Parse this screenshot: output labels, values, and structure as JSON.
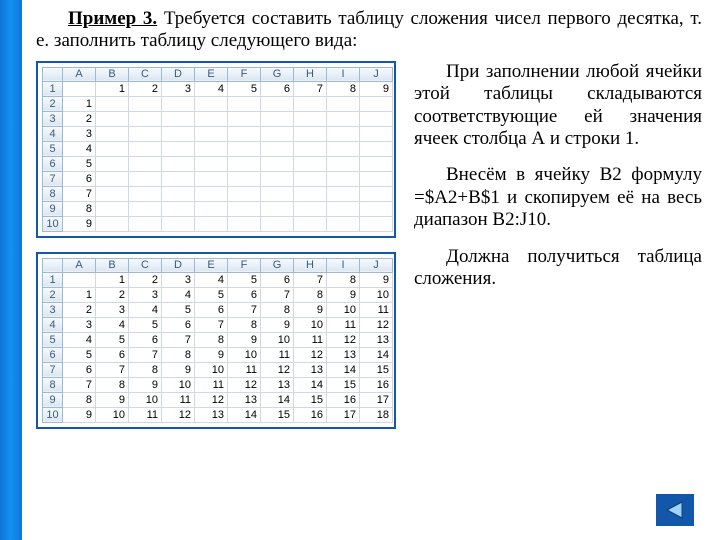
{
  "heading": "Пример 3.",
  "intro_tail": " Требуется составить таблицу сложения чисел первого десятка, т. е. заполнить таблицу следующего вида:",
  "para1": "При заполнении любой ячейки этой таблицы складываются соответствующие ей значения ячеек столбца А и строки 1.",
  "para2": "Внесём в ячейку В2 формулу =$A2+B$1 и скопируем её на весь диапазон В2:J10.",
  "para3": "Должна получиться таблица сложения.",
  "chart_data": [
    {
      "type": "table",
      "title": "Исходная таблица",
      "col_headers": [
        "",
        "A",
        "B",
        "C",
        "D",
        "E",
        "F",
        "G",
        "H",
        "I",
        "J"
      ],
      "row_headers": [
        "1",
        "2",
        "3",
        "4",
        "5",
        "6",
        "7",
        "8",
        "9",
        "10"
      ],
      "cells": [
        [
          "",
          "1",
          "2",
          "3",
          "4",
          "5",
          "6",
          "7",
          "8",
          "9"
        ],
        [
          "1",
          "",
          "",
          "",
          "",
          "",
          "",
          "",
          "",
          ""
        ],
        [
          "2",
          "",
          "",
          "",
          "",
          "",
          "",
          "",
          "",
          ""
        ],
        [
          "3",
          "",
          "",
          "",
          "",
          "",
          "",
          "",
          "",
          ""
        ],
        [
          "4",
          "",
          "",
          "",
          "",
          "",
          "",
          "",
          "",
          ""
        ],
        [
          "5",
          "",
          "",
          "",
          "",
          "",
          "",
          "",
          "",
          ""
        ],
        [
          "6",
          "",
          "",
          "",
          "",
          "",
          "",
          "",
          "",
          ""
        ],
        [
          "7",
          "",
          "",
          "",
          "",
          "",
          "",
          "",
          "",
          ""
        ],
        [
          "8",
          "",
          "",
          "",
          "",
          "",
          "",
          "",
          "",
          ""
        ],
        [
          "9",
          "",
          "",
          "",
          "",
          "",
          "",
          "",
          "",
          ""
        ]
      ]
    },
    {
      "type": "table",
      "title": "Таблица сложения",
      "col_headers": [
        "",
        "A",
        "B",
        "C",
        "D",
        "E",
        "F",
        "G",
        "H",
        "I",
        "J"
      ],
      "row_headers": [
        "1",
        "2",
        "3",
        "4",
        "5",
        "6",
        "7",
        "8",
        "9",
        "10"
      ],
      "cells": [
        [
          "",
          "1",
          "2",
          "3",
          "4",
          "5",
          "6",
          "7",
          "8",
          "9"
        ],
        [
          "1",
          "2",
          "3",
          "4",
          "5",
          "6",
          "7",
          "8",
          "9",
          "10"
        ],
        [
          "2",
          "3",
          "4",
          "5",
          "6",
          "7",
          "8",
          "9",
          "10",
          "11"
        ],
        [
          "3",
          "4",
          "5",
          "6",
          "7",
          "8",
          "9",
          "10",
          "11",
          "12"
        ],
        [
          "4",
          "5",
          "6",
          "7",
          "8",
          "9",
          "10",
          "11",
          "12",
          "13"
        ],
        [
          "5",
          "6",
          "7",
          "8",
          "9",
          "10",
          "11",
          "12",
          "13",
          "14"
        ],
        [
          "6",
          "7",
          "8",
          "9",
          "10",
          "11",
          "12",
          "13",
          "14",
          "15"
        ],
        [
          "7",
          "8",
          "9",
          "10",
          "11",
          "12",
          "13",
          "14",
          "15",
          "16"
        ],
        [
          "8",
          "9",
          "10",
          "11",
          "12",
          "13",
          "14",
          "15",
          "16",
          "17"
        ],
        [
          "9",
          "10",
          "11",
          "12",
          "13",
          "14",
          "15",
          "16",
          "17",
          "18"
        ]
      ]
    }
  ],
  "nav": {
    "back_icon": "triangle-left"
  }
}
